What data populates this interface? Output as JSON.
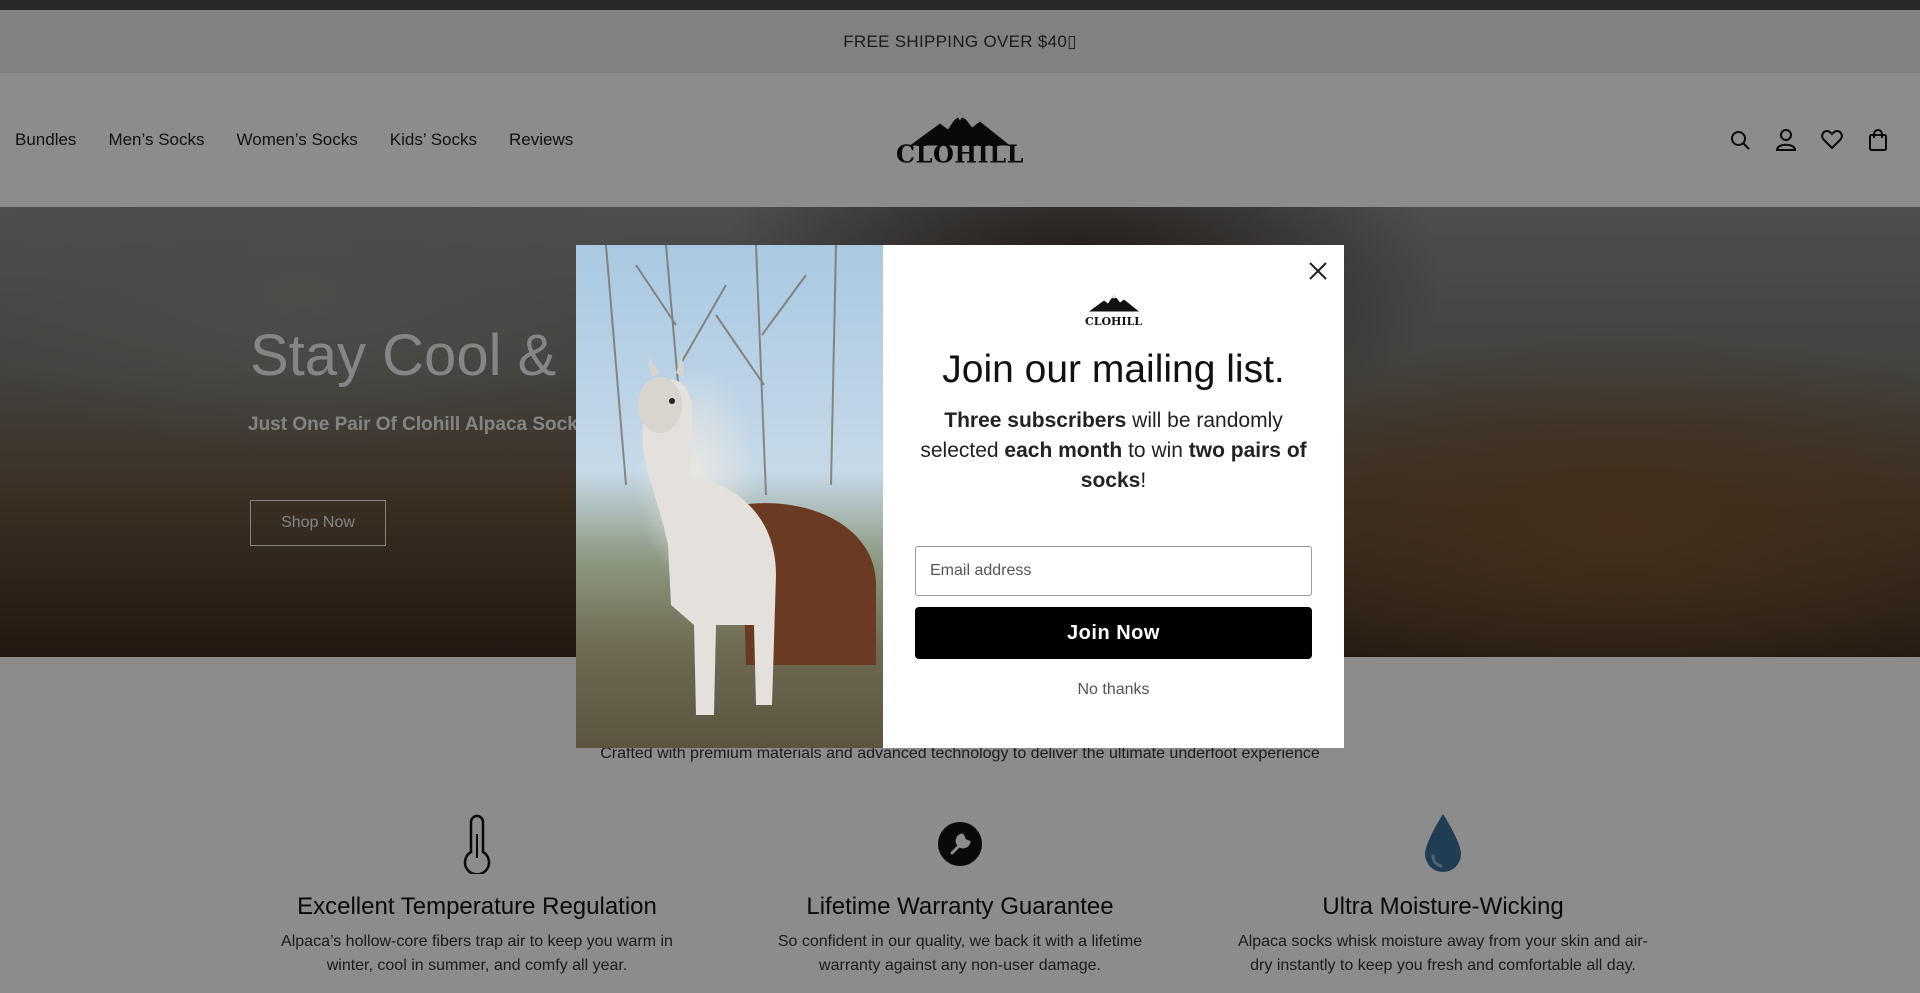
{
  "announcement": "FREE SHIPPING OVER $40▯",
  "nav": {
    "items": [
      "Bundles",
      "Men’s Socks",
      "Women’s Socks",
      "Kids’ Socks",
      "Reviews"
    ]
  },
  "brand": {
    "name": "CLOHILL"
  },
  "header_icons": [
    "search-icon",
    "account-icon",
    "wishlist-icon",
    "cart-icon"
  ],
  "hero": {
    "title": "Stay Cool &",
    "subtitle": "Just One Pair Of Clohill Alpaca Socks.",
    "button": "Shop Now"
  },
  "features_section": {
    "subtitle": "Crafted with premium materials and advanced technology to deliver the ultimate underfoot experience",
    "items": [
      {
        "icon": "thermometer-icon",
        "title": "Excellent Temperature Regulation",
        "text": "Alpaca’s hollow-core fibers trap air to keep you warm in winter, cool in summer, and comfy all year."
      },
      {
        "icon": "wrench-icon",
        "title": "Lifetime Warranty Guarantee",
        "text": "So confident in our quality, we back it with a lifetime warranty against any non-user damage."
      },
      {
        "icon": "water-drop-icon",
        "title": "Ultra Moisture-Wicking",
        "text": "Alpaca socks whisk moisture away from your skin and air-dry instantly to keep you fresh and comfortable all day."
      }
    ]
  },
  "modal": {
    "brand": "CLOHILL",
    "title": "Join our mailing list.",
    "desc_parts": {
      "b1": "Three subscribers",
      "t1": " will be randomly selected ",
      "b2": "each month",
      "t2": " to win ",
      "b3": "two pairs of socks",
      "t3": "!"
    },
    "email_placeholder": "Email address",
    "join_button": "Join Now",
    "decline": "No thanks"
  },
  "colors": {
    "overlay": "#00000073",
    "button": "#000000",
    "drop": "#3d6f98"
  }
}
